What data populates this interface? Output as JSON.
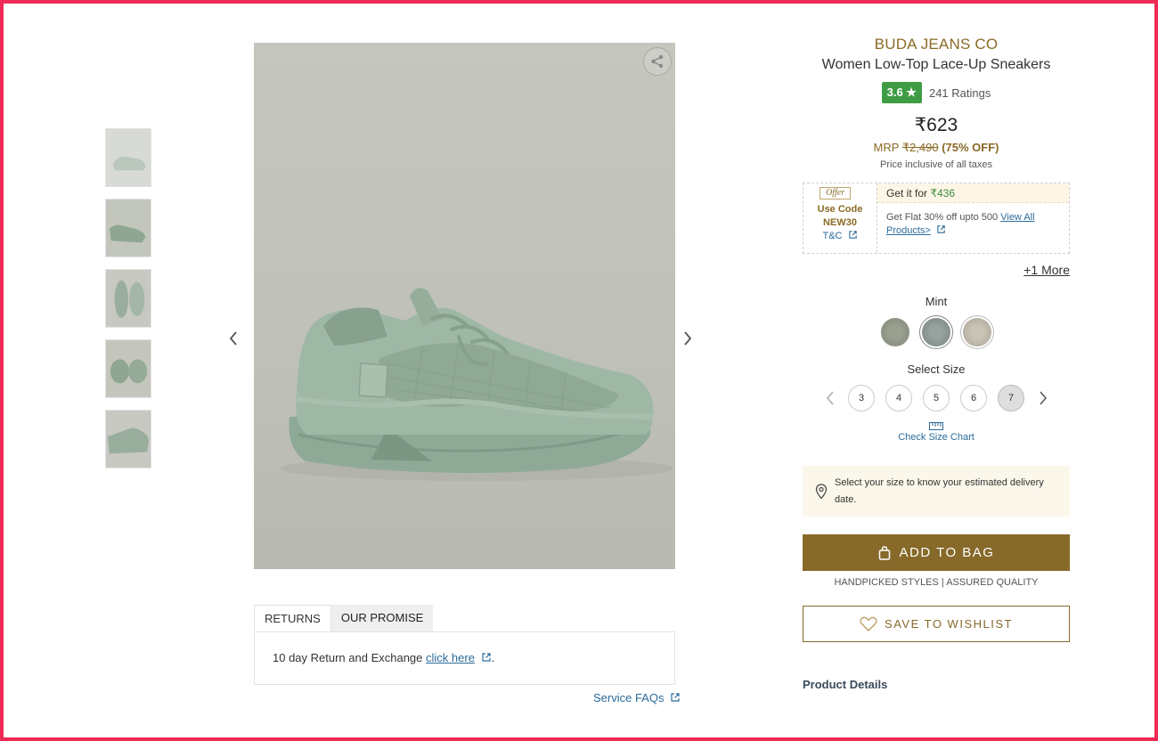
{
  "product": {
    "brand": "BUDA JEANS CO",
    "name": "Women Low-Top Lace-Up Sneakers",
    "rating": "3.6 ★",
    "ratings_count": "241 Ratings",
    "price": "₹623",
    "mrp_label": "MRP",
    "mrp": "₹2,490",
    "discount": "(75% OFF)",
    "tax_note": "Price inclusive of all taxes"
  },
  "offer": {
    "tag": "Offer",
    "use_code": "Use Code",
    "code": "NEW30",
    "tc": "T&C",
    "get_it_for": "Get it for",
    "offer_price": "₹436",
    "description": "Get Flat 30% off upto 500",
    "view_all": "View All Products>",
    "more": "+1 More"
  },
  "color": {
    "label": "Mint",
    "swatches": [
      {
        "name": "olive",
        "color": "#8e9585",
        "selected": false
      },
      {
        "name": "mint",
        "color": "#8b9794",
        "selected": true
      },
      {
        "name": "beige",
        "color": "#bdb7a8",
        "selected": false
      }
    ]
  },
  "size": {
    "label": "Select Size",
    "options": [
      "3",
      "4",
      "5",
      "6",
      "7"
    ],
    "selected": "7",
    "chart_link": "Check Size Chart"
  },
  "delivery": {
    "text": "Select your size to know your estimated delivery date."
  },
  "actions": {
    "add_to_bag": "ADD TO BAG",
    "assured": "HANDPICKED STYLES | ASSURED QUALITY",
    "wishlist": "SAVE TO WISHLIST"
  },
  "section": {
    "product_details": "Product Details"
  },
  "tabs": {
    "returns": "RETURNS",
    "promise": "OUR PROMISE",
    "returns_text": "10 day Return and Exchange",
    "click_here": "click here",
    "service_faqs": "Service FAQs"
  },
  "icons": {
    "share": "share-icon",
    "prev": "chevron-left-icon",
    "next": "chevron-right-icon",
    "external": "external-link-icon",
    "location": "location-pin-icon",
    "bag": "shopping-bag-icon",
    "heart": "heart-icon",
    "ruler": "ruler-icon"
  },
  "colors": {
    "accent": "#87692a",
    "brand": "#8a6a26",
    "rating_bg": "#3f9c45",
    "link": "#2c6b9a",
    "frame": "#ee2a55"
  }
}
